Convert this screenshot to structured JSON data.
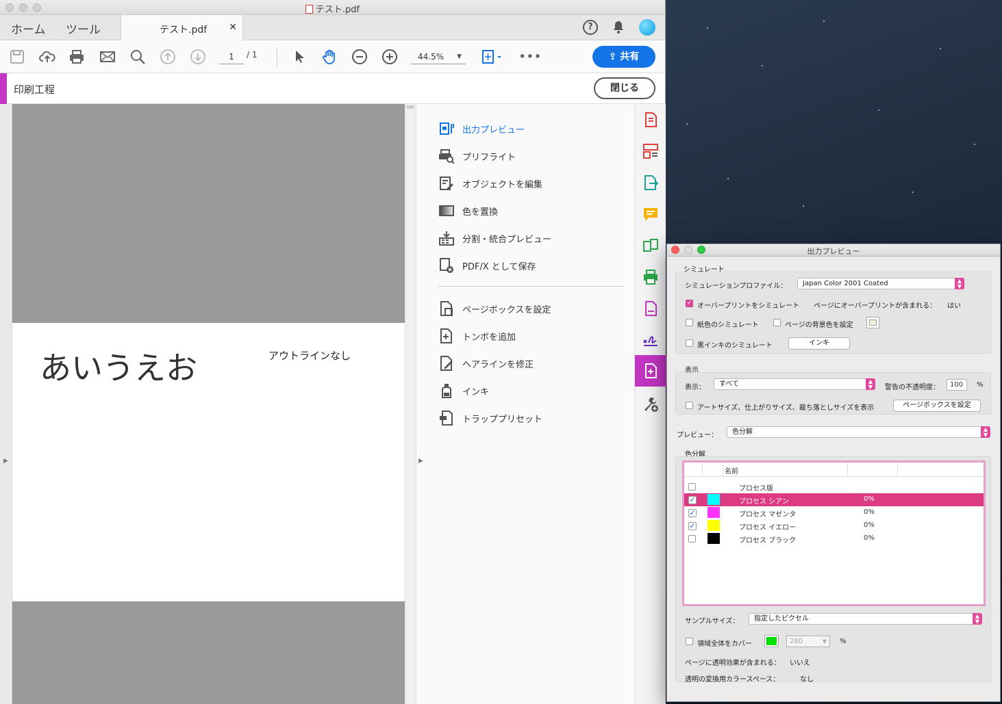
{
  "window": {
    "title": "テスト.pdf"
  },
  "tabs": {
    "home": "ホーム",
    "tools": "ツール",
    "doc": "テスト.pdf"
  },
  "toolbar": {
    "page_current": "1",
    "page_total": "/ 1",
    "zoom": "44.5%",
    "share_label": "共有"
  },
  "tool_header": {
    "name": "印刷工程",
    "close_label": "閉じる"
  },
  "document": {
    "big_text": "あいうえお",
    "note_text": "アウトラインなし"
  },
  "panel": {
    "items": [
      {
        "label": "出力プレビュー"
      },
      {
        "label": "プリフライト"
      },
      {
        "label": "オブジェクトを編集"
      },
      {
        "label": "色を置換"
      },
      {
        "label": "分割・統合プレビュー"
      },
      {
        "label": "PDF/X として保存"
      },
      {
        "label": "ページボックスを設定"
      },
      {
        "label": "トンボを追加"
      },
      {
        "label": "ヘアラインを修正"
      },
      {
        "label": "インキ"
      },
      {
        "label": "トラッププリセット"
      }
    ]
  },
  "dialog": {
    "title": "出力プレビュー",
    "sim_group": "シミュレート",
    "sim_profile_label": "シミュレーションプロファイル：",
    "sim_profile_value": "Japan Color 2001 Coated",
    "overprint_label": "オーバープリントをシミュレート",
    "overprint_info_label": "ページにオーバープリントが含まれる：",
    "overprint_info_value": "はい",
    "paper_label": "紙色のシミュレート",
    "bg_label": "ページの背景色を設定",
    "black_label": "黒インキのシミュレート",
    "ink_button": "インキ",
    "display_group": "表示",
    "display_label": "表示：",
    "display_value": "すべて",
    "opacity_label": "警告の不透明度：",
    "opacity_value": "100",
    "opacity_unit": "%",
    "art_label": "アートサイズ、仕上がりサイズ、裁ち落としサイズを表示",
    "pagebox_button": "ページボックスを設定",
    "preview_label": "プレビュー：",
    "preview_value": "色分解",
    "sep_group": "色分解",
    "list_header_name": "名前",
    "rows": [
      {
        "name": "プロセス版",
        "percent": ""
      },
      {
        "name": "プロセス シアン",
        "percent": "0%"
      },
      {
        "name": "プロセス マゼンタ",
        "percent": "0%"
      },
      {
        "name": "プロセス イエロー",
        "percent": "0%"
      },
      {
        "name": "プロセス ブラック",
        "percent": "0%"
      }
    ],
    "sample_label": "サンプルサイズ：",
    "sample_value": "指定したピクセル",
    "cover_label": "領域全体をカバー",
    "cover_value": "280",
    "cover_unit": "%",
    "transp_label": "ページに透明効果が含まれる：",
    "transp_value": "いいえ",
    "blend_label": "透明の変換用カラースペース：",
    "blend_value": "なし"
  },
  "colors": {
    "accent": "#1473e6",
    "tool": "#c335c3",
    "dialog_accent": "#e04a9b",
    "cyan": "#00ffff",
    "magenta": "#ff33ff",
    "yellow": "#ffff00",
    "black": "#000000",
    "cover_swatch": "#00e000"
  }
}
